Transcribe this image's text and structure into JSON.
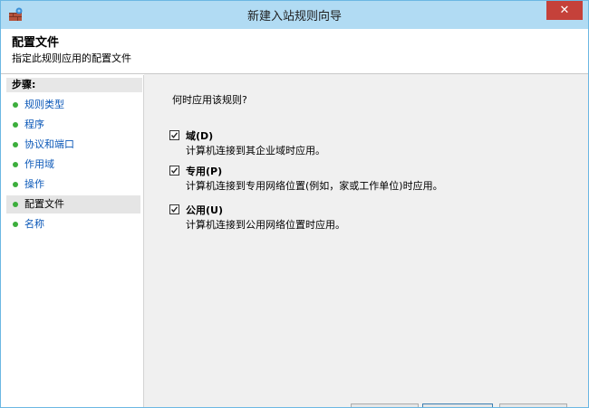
{
  "window": {
    "title": "新建入站规则向导",
    "close_label": "✕"
  },
  "header": {
    "title": "配置文件",
    "subtitle": "指定此规则应用的配置文件"
  },
  "sidebar": {
    "title": "步骤:",
    "items": [
      {
        "label": "规则类型"
      },
      {
        "label": "程序"
      },
      {
        "label": "协议和端口"
      },
      {
        "label": "作用域"
      },
      {
        "label": "操作"
      },
      {
        "label": "配置文件"
      },
      {
        "label": "名称"
      }
    ],
    "active_index": 5
  },
  "main": {
    "question": "何时应用该规则?",
    "options": [
      {
        "title": "域(D)",
        "description": "计算机连接到其企业域时应用。",
        "checked": true
      },
      {
        "title": "专用(P)",
        "description": "计算机连接到专用网络位置(例如，家或工作单位)时应用。",
        "checked": true
      },
      {
        "title": "公用(U)",
        "description": "计算机连接到公用网络位置时应用。",
        "checked": true
      }
    ]
  },
  "colors": {
    "titlebar": "#b1dbf3",
    "close": "#c5413a",
    "link": "#0b58b8",
    "bullet": "#3cae3c"
  }
}
